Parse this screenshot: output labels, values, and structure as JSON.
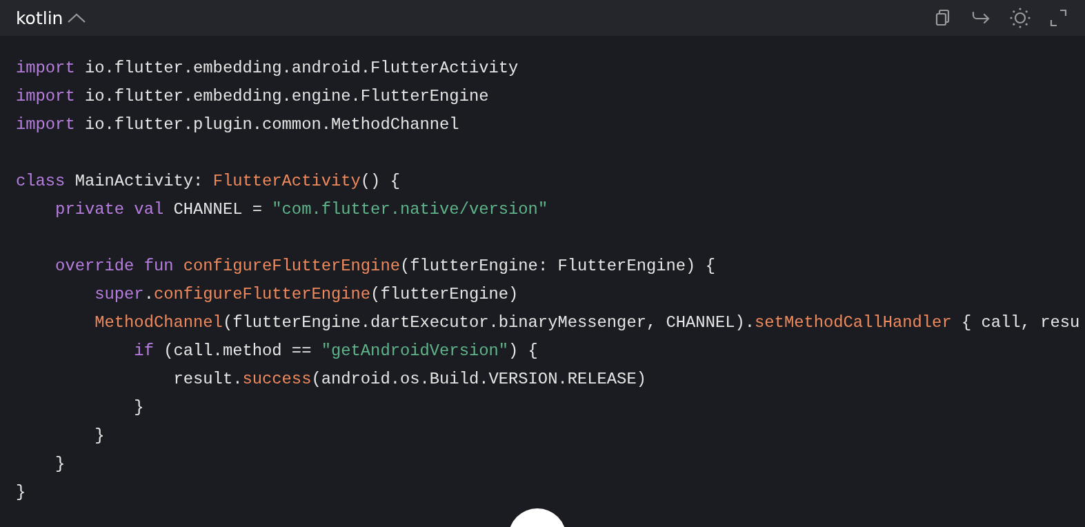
{
  "header": {
    "language": "kotlin"
  },
  "code_lines": [
    {
      "kind": "code",
      "tokens": [
        {
          "kind": "keyword",
          "text": "import"
        },
        {
          "kind": "plain",
          "text": " io.flutter.embedding.android.FlutterActivity"
        }
      ]
    },
    {
      "kind": "code",
      "tokens": [
        {
          "kind": "keyword",
          "text": "import"
        },
        {
          "kind": "plain",
          "text": " io.flutter.embedding.engine.FlutterEngine"
        }
      ]
    },
    {
      "kind": "code",
      "tokens": [
        {
          "kind": "keyword",
          "text": "import"
        },
        {
          "kind": "plain",
          "text": " io.flutter.plugin.common.MethodChannel"
        }
      ]
    },
    {
      "kind": "blank"
    },
    {
      "kind": "code",
      "tokens": [
        {
          "kind": "keyword",
          "text": "class"
        },
        {
          "kind": "plain",
          "text": " MainActivity: "
        },
        {
          "kind": "function",
          "text": "FlutterActivity"
        },
        {
          "kind": "plain",
          "text": "() {"
        }
      ]
    },
    {
      "kind": "code",
      "tokens": [
        {
          "kind": "keyword",
          "text": "    private val"
        },
        {
          "kind": "plain",
          "text": " CHANNEL = "
        },
        {
          "kind": "string",
          "text": "\"com.flutter.native/version\""
        }
      ]
    },
    {
      "kind": "blank"
    },
    {
      "kind": "code",
      "tokens": [
        {
          "kind": "keyword",
          "text": "    override fun "
        },
        {
          "kind": "function",
          "text": "configureFlutterEngine"
        },
        {
          "kind": "plain",
          "text": "(flutterEngine: FlutterEngine) {"
        }
      ]
    },
    {
      "kind": "code",
      "tokens": [
        {
          "kind": "keyword",
          "text": "        super"
        },
        {
          "kind": "plain",
          "text": "."
        },
        {
          "kind": "function",
          "text": "configureFlutterEngine"
        },
        {
          "kind": "plain",
          "text": "(flutterEngine)"
        }
      ]
    },
    {
      "kind": "code",
      "tokens": [
        {
          "kind": "function",
          "text": "        MethodChannel"
        },
        {
          "kind": "plain",
          "text": "(flutterEngine.dartExecutor.binaryMessenger, CHANNEL)."
        },
        {
          "kind": "function",
          "text": "setMethodCallHandler"
        },
        {
          "kind": "plain",
          "text": " { call, resu"
        }
      ]
    },
    {
      "kind": "code",
      "tokens": [
        {
          "kind": "keyword",
          "text": "            if"
        },
        {
          "kind": "plain",
          "text": " (call.method == "
        },
        {
          "kind": "string",
          "text": "\"getAndroidVersion\""
        },
        {
          "kind": "plain",
          "text": ") {"
        }
      ]
    },
    {
      "kind": "code",
      "tokens": [
        {
          "kind": "plain",
          "text": "                result."
        },
        {
          "kind": "function",
          "text": "success"
        },
        {
          "kind": "plain",
          "text": "(android.os.Build.VERSION.RELEASE)"
        }
      ]
    },
    {
      "kind": "code",
      "tokens": [
        {
          "kind": "plain",
          "text": "            }"
        }
      ]
    },
    {
      "kind": "code",
      "tokens": [
        {
          "kind": "plain",
          "text": "        }"
        }
      ]
    },
    {
      "kind": "code",
      "tokens": [
        {
          "kind": "plain",
          "text": "    }"
        }
      ]
    },
    {
      "kind": "code",
      "tokens": [
        {
          "kind": "plain",
          "text": "}"
        }
      ]
    }
  ]
}
